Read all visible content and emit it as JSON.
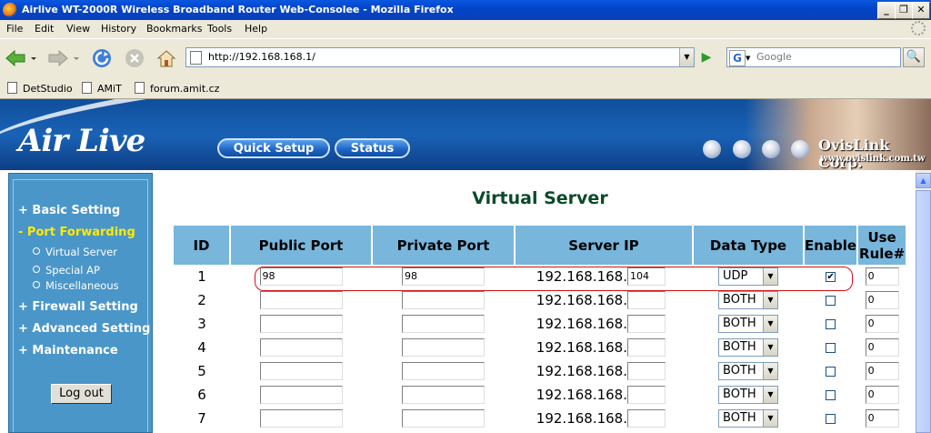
{
  "window": {
    "title": "Airlive WT-2000R Wireless Broadband Router Web-Consolee - Mozilla Firefox",
    "min": "_",
    "max": "❐",
    "close": "✕"
  },
  "menu": [
    "File",
    "Edit",
    "View",
    "History",
    "Bookmarks",
    "Tools",
    "Help"
  ],
  "nav": {
    "url": "http://192.168.168.1/",
    "search_placeholder": "Google",
    "search_engine": "G"
  },
  "bookmarks": [
    "DetStudio",
    "AMiT",
    "forum.amit.cz"
  ],
  "header": {
    "logo": "Air Live",
    "quick_setup": "Quick Setup",
    "status": "Status",
    "brand": "OvisLink Corp.",
    "brand_url": "www.ovislink.com.tw"
  },
  "sidebar": {
    "basic": "+ Basic Setting",
    "port_forwarding": "- Port Forwarding",
    "virtual_server": "Virtual Server",
    "special_ap": "Special AP",
    "misc": "Miscellaneous",
    "firewall": "+ Firewall Setting",
    "advanced": "+ Advanced Setting",
    "maintenance": "+ Maintenance",
    "logout": "Log out"
  },
  "page": {
    "title": "Virtual Server"
  },
  "table": {
    "headers": {
      "id": "ID",
      "public_port": "Public Port",
      "private_port": "Private Port",
      "server_ip": "Server IP",
      "data_type": "Data Type",
      "enable": "Enable",
      "use_rule": "Use Rule#"
    },
    "ip_prefix": "192.168.168.",
    "rows": [
      {
        "id": "1",
        "public": "98",
        "private": "98",
        "ip_last": "104",
        "type": "UDP",
        "enabled": "✔",
        "rule": "0"
      },
      {
        "id": "2",
        "public": "",
        "private": "",
        "ip_last": "",
        "type": "BOTH",
        "enabled": "",
        "rule": "0"
      },
      {
        "id": "3",
        "public": "",
        "private": "",
        "ip_last": "",
        "type": "BOTH",
        "enabled": "",
        "rule": "0"
      },
      {
        "id": "4",
        "public": "",
        "private": "",
        "ip_last": "",
        "type": "BOTH",
        "enabled": "",
        "rule": "0"
      },
      {
        "id": "5",
        "public": "",
        "private": "",
        "ip_last": "",
        "type": "BOTH",
        "enabled": "",
        "rule": "0"
      },
      {
        "id": "6",
        "public": "",
        "private": "",
        "ip_last": "",
        "type": "BOTH",
        "enabled": "",
        "rule": "0"
      },
      {
        "id": "7",
        "public": "",
        "private": "",
        "ip_last": "",
        "type": "BOTH",
        "enabled": "",
        "rule": "0"
      }
    ]
  },
  "colors": {
    "accent": "#78b6dc",
    "sidebar": "#4a96c9",
    "highlight": "#d0101a"
  }
}
